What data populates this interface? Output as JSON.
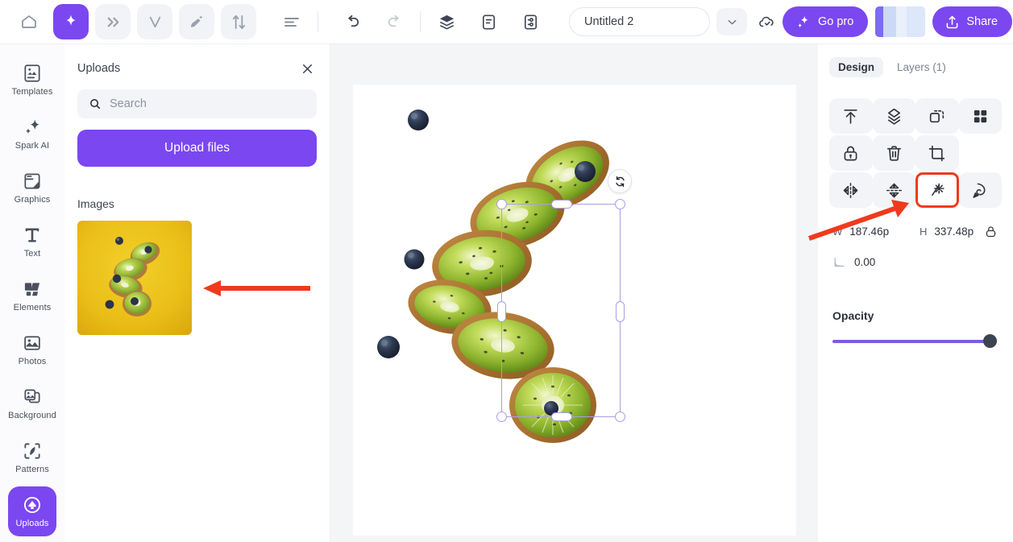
{
  "topbar": {
    "home_icon": "home-icon",
    "spark_icon": "sparkle-icon",
    "forward_icon": "double-chevron-right-icon",
    "v_icon": "letter-v-icon",
    "magic_icon": "magic-paint-icon",
    "swap_icon": "swap-arrows-icon",
    "menu_icon": "hamburger-menu-icon",
    "undo_icon": "undo-icon",
    "redo_icon": "redo-icon",
    "layers_icon": "layers-stack-icon",
    "notes_icon": "document-icon",
    "resize_icon": "resize-panel-icon",
    "title_value": "Untitled 2",
    "chevron_icon": "chevron-down-icon",
    "cloud_icon": "cloud-saved-icon",
    "gopro_label": "Go pro",
    "gopro_icon": "sparkle-icon",
    "share_label": "Share",
    "share_icon": "share-upload-icon"
  },
  "rail": {
    "items": [
      {
        "label": "Templates",
        "icon": "templates-icon",
        "active": false
      },
      {
        "label": "Spark AI",
        "icon": "sparkle-icon",
        "active": false
      },
      {
        "label": "Graphics",
        "icon": "graphics-icon",
        "active": false
      },
      {
        "label": "Text",
        "icon": "text-icon",
        "active": false
      },
      {
        "label": "Elements",
        "icon": "elements-icon",
        "active": false
      },
      {
        "label": "Photos",
        "icon": "photos-icon",
        "active": false
      },
      {
        "label": "Background",
        "icon": "background-icon",
        "active": false
      },
      {
        "label": "Patterns",
        "icon": "patterns-icon",
        "active": false
      },
      {
        "label": "Uploads",
        "icon": "uploads-icon",
        "active": true
      }
    ]
  },
  "uploads_panel": {
    "title": "Uploads",
    "close_icon": "close-icon",
    "search_placeholder": "Search",
    "search_value": "",
    "search_icon": "search-icon",
    "upload_button": "Upload files",
    "images_section_title": "Images",
    "thumbnail_alt": "kiwi-slices-on-yellow-background"
  },
  "canvas": {
    "rotate_icon": "rotate-handle-icon",
    "artwork_alt": "kiwi-slices-cutout"
  },
  "right_panel": {
    "tabs": [
      {
        "label": "Design",
        "active": true
      },
      {
        "label": "Layers (1)",
        "active": false
      }
    ],
    "tools": [
      {
        "name": "bring-to-front-button",
        "icon": "arrow-up-to-line-icon",
        "chip": true,
        "highlighted": false
      },
      {
        "name": "bring-forward-button",
        "icon": "layers-arrow-up-icon",
        "chip": true,
        "highlighted": false
      },
      {
        "name": "duplicate-button",
        "icon": "duplicate-icon",
        "chip": true,
        "highlighted": false
      },
      {
        "name": "position-grid-button",
        "icon": "grid-four-squares-icon",
        "chip": true,
        "highlighted": false
      },
      {
        "name": "lock-button",
        "icon": "lock-icon",
        "chip": true,
        "highlighted": false
      },
      {
        "name": "delete-button",
        "icon": "trash-icon",
        "chip": true,
        "highlighted": false
      },
      {
        "name": "crop-button",
        "icon": "crop-icon",
        "chip": true,
        "highlighted": false
      },
      {
        "name": "empty-slot",
        "icon": "",
        "chip": false,
        "highlighted": false
      },
      {
        "name": "flip-horizontal-button",
        "icon": "flip-horizontal-icon",
        "chip": true,
        "highlighted": false
      },
      {
        "name": "flip-vertical-button",
        "icon": "flip-vertical-icon",
        "chip": true,
        "highlighted": false
      },
      {
        "name": "magic-wand-button",
        "icon": "magic-wand-icon",
        "chip": false,
        "highlighted": true
      },
      {
        "name": "background-remover-button",
        "icon": "pen-cursor-icon",
        "chip": true,
        "highlighted": false
      }
    ],
    "width_label": "W",
    "width_value": "187.46р",
    "height_label": "H",
    "height_value": "337.48р",
    "lock_ratio_icon": "lock-aspect-ratio-icon",
    "angle_icon": "angle-icon",
    "angle_value": "0.00",
    "opacity_label": "Opacity",
    "opacity_percent": 100,
    "accent_color": "#7b47f0"
  },
  "annotations": {
    "arrow_color": "#ef3a1d",
    "arrow_to_thumbnail": "red-arrow-pointing-left-to-uploaded-image",
    "arrow_to_magic_wand": "red-arrow-pointing-to-magic-wand-tool",
    "highlight_box": "red-box-around-magic-wand-tool"
  }
}
